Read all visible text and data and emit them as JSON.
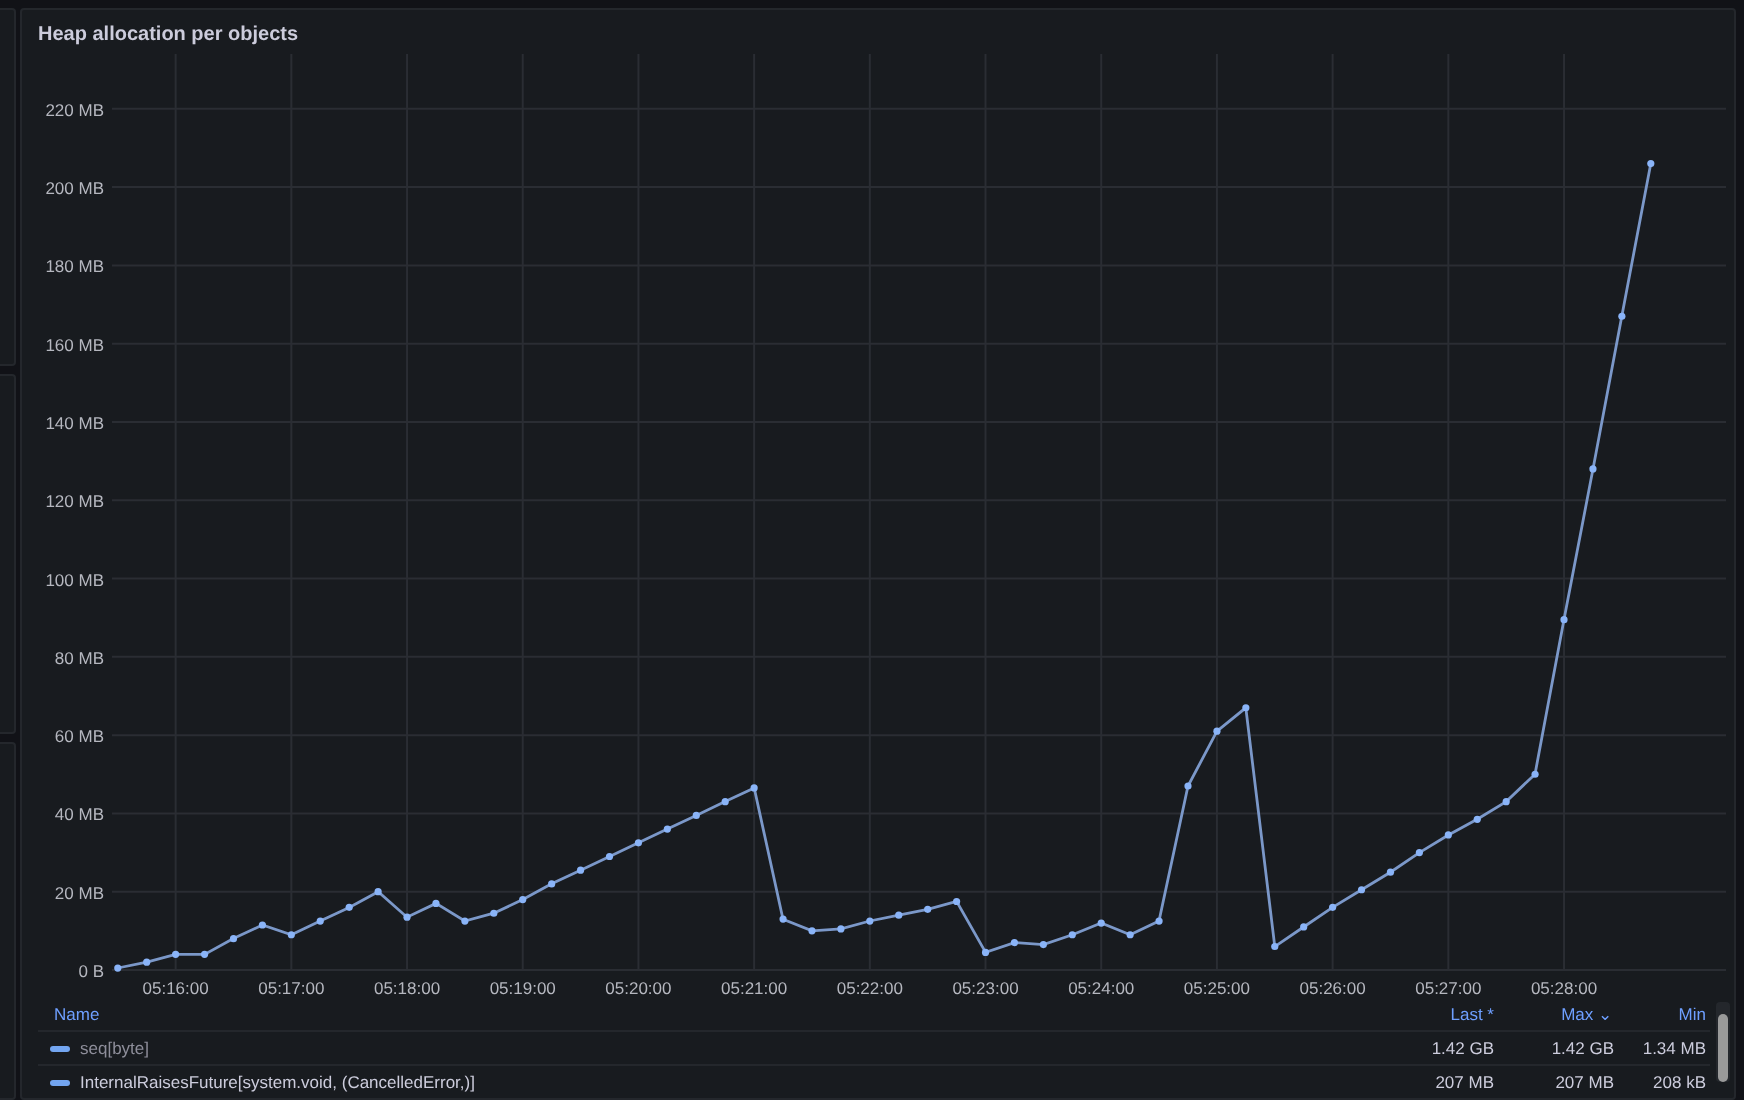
{
  "panel": {
    "title": "Heap allocation per objects",
    "chart_data": {
      "type": "line",
      "categories": [
        null,
        null,
        "05:16:00",
        null,
        null,
        null,
        "05:17:00",
        null,
        null,
        null,
        "05:18:00",
        null,
        null,
        null,
        "05:19:00",
        null,
        null,
        null,
        "05:20:00",
        null,
        null,
        null,
        "05:21:00",
        null,
        null,
        null,
        "05:22:00",
        null,
        null,
        null,
        "05:23:00",
        null,
        null,
        null,
        "05:24:00",
        null,
        null,
        null,
        "05:25:00",
        null,
        null,
        null,
        "05:26:00",
        null,
        null,
        null,
        "05:27:00",
        null,
        null,
        null,
        "05:28:00",
        null,
        null,
        null
      ],
      "grid": true,
      "series": [
        {
          "color": "#7b98c9",
          "marker": true,
          "values": [
            0.5,
            2,
            4,
            4,
            8,
            11.5,
            9,
            12.5,
            16,
            20,
            13.5,
            17,
            12.5,
            14.5,
            18,
            22,
            25.5,
            29,
            32.5,
            36,
            39.5,
            43,
            46.5,
            13,
            10,
            10.5,
            12.5,
            14,
            15.5,
            17.5,
            4.5,
            7,
            6.5,
            9,
            12,
            9,
            12.5,
            47,
            61,
            67,
            6,
            11,
            16,
            20.5,
            25,
            30,
            34.5,
            38.5,
            43,
            50,
            89.5,
            128,
            167,
            206
          ]
        }
      ],
      "ylim": [
        0,
        234
      ],
      "yticks": [
        {
          "value": 0,
          "label": "0 B"
        },
        {
          "value": 20,
          "label": "20 MB"
        },
        {
          "value": 40,
          "label": "40 MB"
        },
        {
          "value": 60,
          "label": "60 MB"
        },
        {
          "value": 80,
          "label": "80 MB"
        },
        {
          "value": 100,
          "label": "100 MB"
        },
        {
          "value": 120,
          "label": "120 MB"
        },
        {
          "value": 140,
          "label": "140 MB"
        },
        {
          "value": 160,
          "label": "160 MB"
        },
        {
          "value": 180,
          "label": "180 MB"
        },
        {
          "value": 200,
          "label": "200 MB"
        },
        {
          "value": 220,
          "label": "220 MB"
        }
      ]
    }
  },
  "legend": {
    "columns": [
      "Name",
      "Last *",
      "Max ⌄",
      "Min"
    ],
    "rows": [
      {
        "name": "seq[byte]",
        "color": "#73a5f0",
        "hidden": true,
        "last": "1.42 GB",
        "max": "1.42 GB",
        "min": "1.34 MB"
      },
      {
        "name": "InternalRaisesFuture[system.void, (CancelledError,)]",
        "color": "#73a5f0",
        "hidden": false,
        "last": "207 MB",
        "max": "207 MB",
        "min": "208 kB"
      }
    ]
  }
}
